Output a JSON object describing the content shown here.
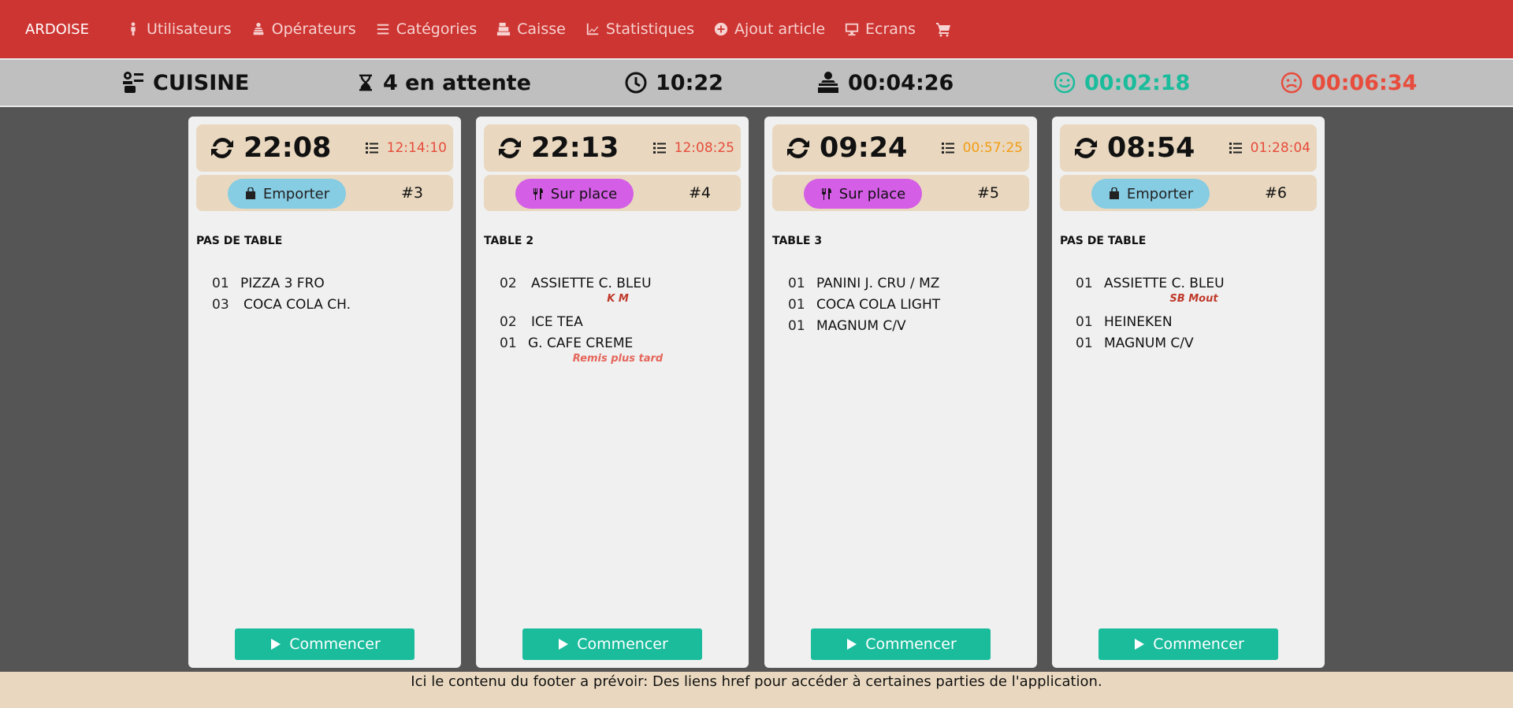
{
  "nav": {
    "brand": "ARDOISE",
    "items": [
      {
        "label": "Utilisateurs",
        "icon": "user-icon"
      },
      {
        "label": "Opérateurs",
        "icon": "operator-icon"
      },
      {
        "label": "Catégories",
        "icon": "list-icon"
      },
      {
        "label": "Caisse",
        "icon": "cash-register-icon"
      },
      {
        "label": "Statistiques",
        "icon": "chart-icon"
      },
      {
        "label": "Ajout article",
        "icon": "plus-circle-icon"
      },
      {
        "label": "Ecrans",
        "icon": "monitor-icon"
      }
    ],
    "cart_icon": "cart-icon"
  },
  "status": {
    "kitchen": "CUISINE",
    "waiting": "4 en attente",
    "clock": "10:22",
    "avg_time": "00:04:26",
    "best_time": "00:02:18",
    "worst_time": "00:06:34",
    "colors": {
      "good": "#1abc9c",
      "bad": "#e74c3c"
    }
  },
  "orders": [
    {
      "time": "22:08",
      "elapsed": "12:14:10",
      "elapsed_color": "#e74c3c",
      "mode": "Emporter",
      "number": "#3",
      "table": "PAS DE TABLE",
      "items": [
        {
          "qty": "01",
          "name": "PIZZA 3 FRO"
        },
        {
          "qty": "03",
          "name": "COCA COLA CH."
        }
      ],
      "button": "Commencer"
    },
    {
      "time": "22:13",
      "elapsed": "12:08:25",
      "elapsed_color": "#e74c3c",
      "mode": "Sur place",
      "number": "#4",
      "table": "TABLE 2",
      "items": [
        {
          "qty": "02",
          "name": "ASSIETTE C. BLEU",
          "note": "K M"
        },
        {
          "qty": "02",
          "name": "ICE TEA"
        },
        {
          "qty": "01",
          "name": "G. CAFE CREME",
          "note": "Remis plus tard"
        }
      ],
      "button": "Commencer"
    },
    {
      "time": "09:24",
      "elapsed": "00:57:25",
      "elapsed_color": "#f39c12",
      "mode": "Sur place",
      "number": "#5",
      "table": "TABLE 3",
      "items": [
        {
          "qty": "01",
          "name": "PANINI J. CRU / MZ"
        },
        {
          "qty": "01",
          "name": "COCA COLA LIGHT"
        },
        {
          "qty": "01",
          "name": "MAGNUM C/V"
        }
      ],
      "button": "Commencer"
    },
    {
      "time": "08:54",
      "elapsed": "01:28:04",
      "elapsed_color": "#e74c3c",
      "mode": "Emporter",
      "number": "#6",
      "table": "PAS DE TABLE",
      "items": [
        {
          "qty": "01",
          "name": "ASSIETTE C. BLEU",
          "note": "SB Mout"
        },
        {
          "qty": "01",
          "name": "HEINEKEN"
        },
        {
          "qty": "01",
          "name": "MAGNUM C/V"
        }
      ],
      "button": "Commencer"
    }
  ],
  "footer": "Ici le contenu du footer a prévoir: Des liens href pour accéder à certaines parties de l'application."
}
